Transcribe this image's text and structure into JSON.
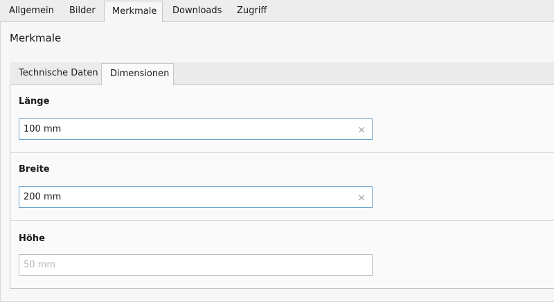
{
  "top_tabs": [
    {
      "label": "Allgemein"
    },
    {
      "label": "Bilder"
    },
    {
      "label": "Merkmale"
    },
    {
      "label": "Downloads"
    },
    {
      "label": "Zugriff"
    }
  ],
  "active_top_tab": "Merkmale",
  "panel": {
    "title": "Merkmale",
    "sub_tabs": [
      {
        "label": "Technische Daten"
      },
      {
        "label": "Dimensionen"
      }
    ],
    "active_sub_tab": "Dimensionen",
    "fields": [
      {
        "label": "Länge",
        "value": "100 mm",
        "placeholder": ""
      },
      {
        "label": "Breite",
        "value": "200 mm",
        "placeholder": ""
      },
      {
        "label": "Höhe",
        "value": "",
        "placeholder": "50 mm"
      }
    ],
    "clear_glyph": "×",
    "clear_icon": "close-icon"
  },
  "colors": {
    "tab_bar_bg": "#ededed",
    "panel_bg": "#f7f7f7",
    "focus_border": "#6aa3cc",
    "input_border": "#bbbbbb"
  }
}
